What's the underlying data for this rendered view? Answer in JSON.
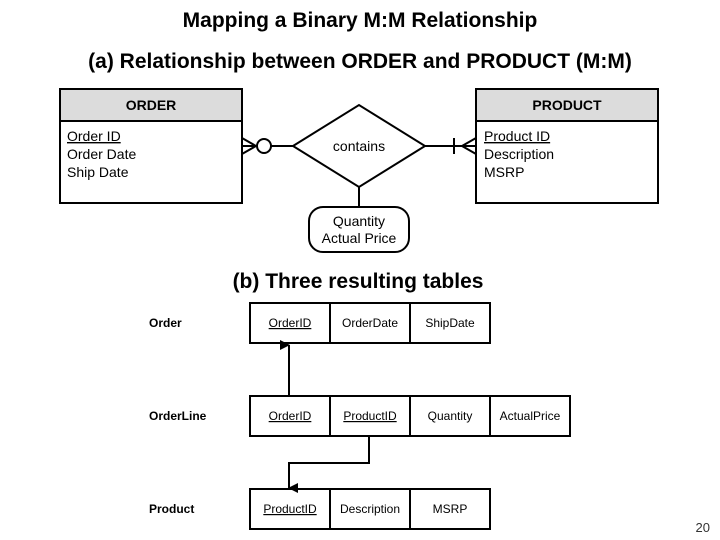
{
  "slide": {
    "title": "Mapping a Binary M:M Relationship",
    "section_a": "(a) Relationship between ORDER and PRODUCT (M:M)",
    "section_b": "(b) Three resulting tables",
    "page_number": "20"
  },
  "er_diagram": {
    "entities": [
      {
        "name": "ORDER",
        "attributes": [
          {
            "label": "Order ID",
            "key": true
          },
          {
            "label": "Order Date",
            "key": false
          },
          {
            "label": "Ship Date",
            "key": false
          }
        ]
      },
      {
        "name": "PRODUCT",
        "attributes": [
          {
            "label": "Product ID",
            "key": true
          },
          {
            "label": "Description",
            "key": false
          },
          {
            "label": "MSRP",
            "key": false
          }
        ]
      }
    ],
    "relationship": {
      "label": "contains",
      "attributes": [
        "Quantity",
        "Actual Price"
      ],
      "order_side_cardinality": "zero-or-many",
      "product_side_cardinality": "one-or-many"
    }
  },
  "tables": [
    {
      "name": "Order",
      "columns": [
        {
          "label": "OrderID",
          "key": true
        },
        {
          "label": "OrderDate",
          "key": false
        },
        {
          "label": "ShipDate",
          "key": false
        }
      ]
    },
    {
      "name": "OrderLine",
      "columns": [
        {
          "label": "OrderID",
          "key": true
        },
        {
          "label": "ProductID",
          "key": true
        },
        {
          "label": "Quantity",
          "key": false
        },
        {
          "label": "ActualPrice",
          "key": false
        }
      ]
    },
    {
      "name": "Product",
      "columns": [
        {
          "label": "ProductID",
          "key": true
        },
        {
          "label": "Description",
          "key": false
        },
        {
          "label": "MSRP",
          "key": false
        }
      ]
    }
  ],
  "foreign_keys": [
    {
      "from": "OrderLine.OrderID",
      "to": "Order.OrderID"
    },
    {
      "from": "OrderLine.ProductID",
      "to": "Product.ProductID"
    }
  ]
}
